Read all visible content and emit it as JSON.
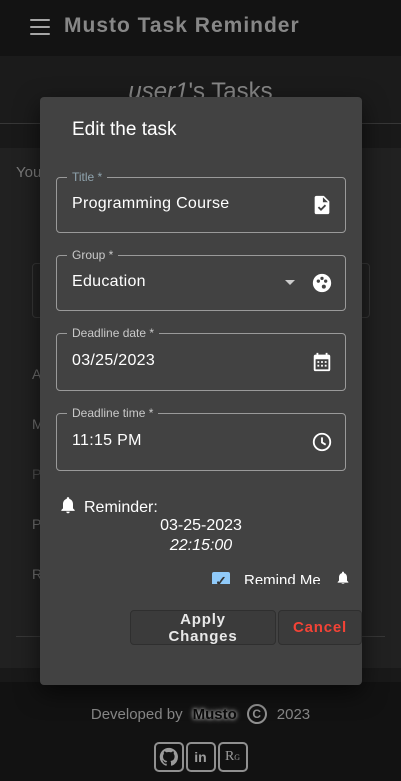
{
  "app": {
    "title": "Musto Task Reminder"
  },
  "page": {
    "title_user": "user1",
    "title_suffix": "'s Tasks",
    "card_intro": "You",
    "row_labels": [
      "A",
      "M",
      "P",
      "P",
      "R"
    ]
  },
  "dialog": {
    "title": "Edit the task",
    "fields": {
      "title": {
        "label": "Title *",
        "value": "Programming Course",
        "icon": "task-file-icon"
      },
      "group": {
        "label": "Group *",
        "value": "Education",
        "icon": "palette-icon"
      },
      "deadline_date": {
        "label": "Deadline date *",
        "value": "03/25/2023",
        "icon": "calendar-icon"
      },
      "deadline_time": {
        "label": "Deadline time *",
        "value": "11:15 PM",
        "icon": "clock-icon"
      }
    },
    "reminder": {
      "label": "Reminder:",
      "date": "03-25-2023",
      "time": "22:15:00"
    },
    "remind_me": {
      "label": "Remind Me",
      "checked": true
    },
    "buttons": {
      "apply": "Apply Changes",
      "cancel": "Cancel"
    }
  },
  "footer": {
    "developed_by": "Developed by",
    "brand": "Musto",
    "copyright_symbol": "C",
    "year": "2023",
    "social": [
      "github-icon",
      "linkedin-icon",
      "researchgate-icon"
    ]
  },
  "colors": {
    "accent": "#90caf9",
    "cancel": "#f44336",
    "dialog_bg": "#424242"
  }
}
